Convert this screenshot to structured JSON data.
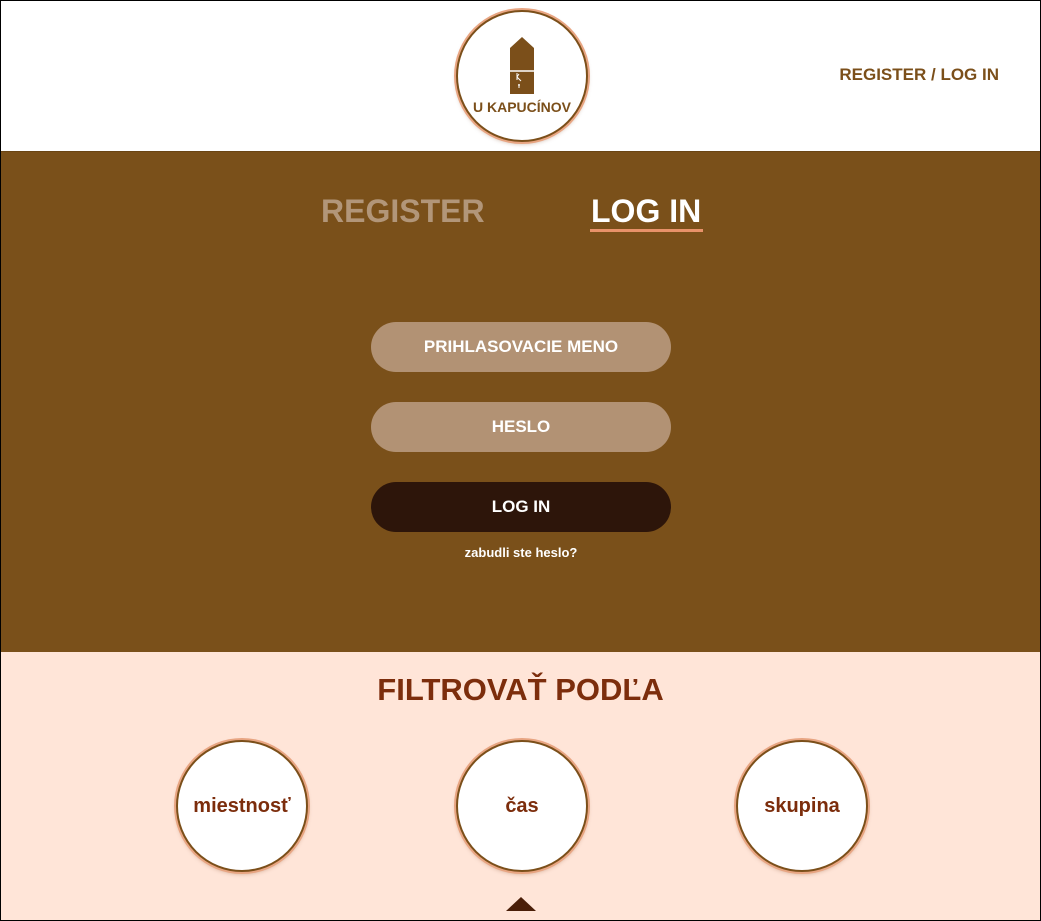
{
  "header": {
    "logo_text": "U KAPUCÍNOV",
    "logo_icon": "house-door-icon",
    "auth_link": "REGISTER / LOG IN"
  },
  "tabs": [
    {
      "label": "REGISTER",
      "active": false
    },
    {
      "label": "LOG IN",
      "active": true
    }
  ],
  "login_form": {
    "username_placeholder": "PRIHLASOVACIE MENO",
    "username_value": "",
    "password_placeholder": "HESLO",
    "password_value": "",
    "submit_label": "LOG IN",
    "forgot_password": "zabudli ste heslo?"
  },
  "filter": {
    "title": "FILTROVAŤ PODĽA",
    "options": [
      "miestnosť",
      "čas",
      "skupina"
    ],
    "scroll_icon": "up-arrow-icon"
  },
  "colors": {
    "brand_brown": "#7a501a",
    "tab_inactive": "#b29679",
    "tab_underline": "#e8926a",
    "field_bg": "#b29274",
    "button_dark": "#2d150a",
    "filter_bg": "#ffe5d8",
    "filter_text": "#7c2d0c"
  }
}
